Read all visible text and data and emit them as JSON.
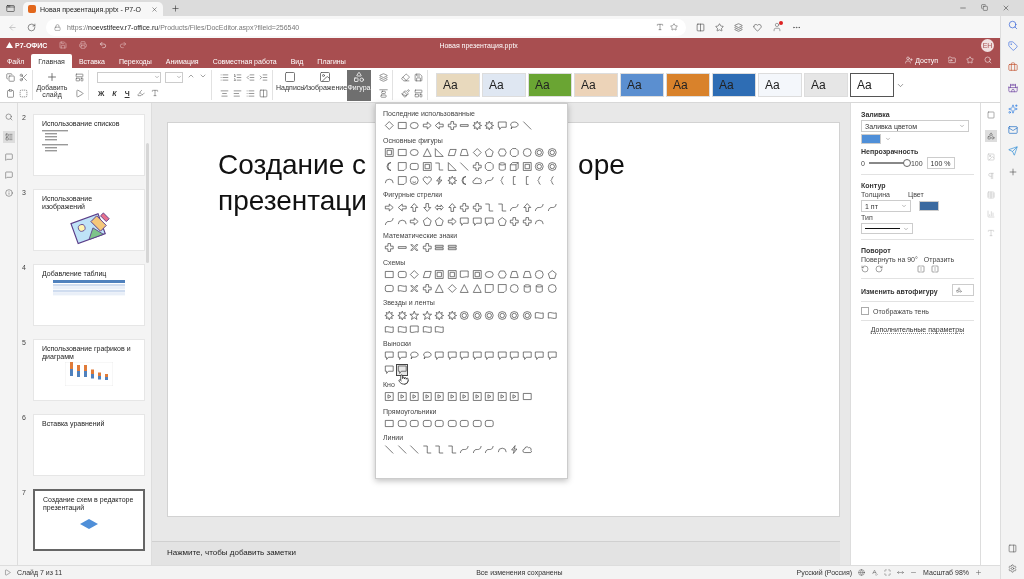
{
  "browser": {
    "tab_title": "Новая презентация.pptx - Р7-О",
    "url": "https://**noevstifeev.r7-office.ru**/Products/Files/DocEditor.aspx?fileid=256540"
  },
  "app": {
    "logo": "Р7-ОФИС",
    "title": "Новая презентация.pptx",
    "avatar": "ЕН",
    "share": "Доступ"
  },
  "menu": [
    {
      "label": "Файл",
      "selected": false
    },
    {
      "label": "Главная",
      "selected": true
    },
    {
      "label": "Вставка",
      "selected": false
    },
    {
      "label": "Переходы",
      "selected": false
    },
    {
      "label": "Анимация",
      "selected": false
    },
    {
      "label": "Совместная работа",
      "selected": false
    },
    {
      "label": "Вид",
      "selected": false
    },
    {
      "label": "Плагины",
      "selected": false
    }
  ],
  "toolbar": {
    "add_slide": "Добавить слайд",
    "bold": "Ж",
    "italic": "К",
    "underline": "Ч",
    "textbox": "Надпись",
    "image": "Изображение",
    "shape": {
      "label": "Фигура",
      "selected": true
    }
  },
  "themes": [
    {
      "label": "Aa",
      "color": "#e8d9bd",
      "selected": false
    },
    {
      "label": "Aa",
      "color": "#dfe7f2",
      "selected": false
    },
    {
      "label": "Aa",
      "color": "#6aa533",
      "selected": false
    },
    {
      "label": "Aa",
      "color": "#ecd3b8",
      "selected": false
    },
    {
      "label": "Aa",
      "color": "#5b8fd0",
      "selected": false
    },
    {
      "label": "Aa",
      "color": "#d9822b",
      "selected": false
    },
    {
      "label": "Aa",
      "color": "#2e6db4",
      "selected": false
    },
    {
      "label": "Aa",
      "color": "#f4f7fb",
      "selected": false
    },
    {
      "label": "Aa",
      "color": "#e6e6e6",
      "selected": false
    },
    {
      "label": "Aa",
      "color": "#ffffff",
      "selected": true
    }
  ],
  "slides": [
    {
      "number": "2",
      "title": "Использование списков",
      "kind": "list",
      "selected": false
    },
    {
      "number": "3",
      "title": "Использование изображений",
      "kind": "image",
      "selected": false
    },
    {
      "number": "4",
      "title": "Добавление таблиц",
      "kind": "table",
      "selected": false
    },
    {
      "number": "5",
      "title": "Использование графиков и диаграмм",
      "kind": "chart",
      "selected": false
    },
    {
      "number": "6",
      "title": "Вставка уравнений",
      "kind": "blank",
      "selected": false
    },
    {
      "number": "7",
      "title": "Создание схем в редакторе презентаций",
      "kind": "diamond",
      "selected": true
    }
  ],
  "slide_title": {
    "line1_start": "Создание с",
    "line1_end": "оре",
    "line2": "презентаци"
  },
  "shape_menu": {
    "sections": [
      {
        "title": "Последние использованные",
        "shapes": [
          {
            "kind": "diamond",
            "selected": false
          },
          {
            "kind": "rect",
            "selected": false
          },
          {
            "kind": "ellipse",
            "selected": false
          },
          {
            "kind": "arrow-right",
            "selected": false
          },
          {
            "kind": "arrow-left",
            "selected": false
          },
          {
            "kind": "cross",
            "selected": false
          },
          {
            "kind": "minus",
            "selected": false
          },
          {
            "kind": "burst",
            "selected": false
          },
          {
            "kind": "burst",
            "selected": false
          },
          {
            "kind": "callout",
            "selected": false
          },
          {
            "kind": "callout-round",
            "selected": false
          },
          {
            "kind": "line",
            "selected": false
          }
        ]
      },
      {
        "title": "Основные фигуры",
        "shapes": [
          {
            "kind": "frame",
            "selected": false
          },
          {
            "kind": "rect",
            "selected": false
          },
          {
            "kind": "ellipse",
            "selected": false
          },
          {
            "kind": "triangle",
            "selected": false
          },
          {
            "kind": "rtriangle",
            "selected": false
          },
          {
            "kind": "parallelogram",
            "selected": false
          },
          {
            "kind": "trapezoid",
            "selected": false
          },
          {
            "kind": "diamond",
            "selected": false
          },
          {
            "kind": "pentagon",
            "selected": false
          },
          {
            "kind": "hexagon",
            "selected": false
          },
          {
            "kind": "octagon",
            "selected": false
          },
          {
            "kind": "circle",
            "selected": false
          },
          {
            "kind": "donut",
            "selected": false
          },
          {
            "kind": "donut",
            "selected": false
          },
          {
            "kind": "moon",
            "selected": false
          },
          {
            "kind": "foldedcorner",
            "selected": false
          },
          {
            "kind": "rounded",
            "selected": false
          },
          {
            "kind": "frame",
            "selected": false
          },
          {
            "kind": "elbow",
            "selected": false
          },
          {
            "kind": "rtriangle",
            "selected": false
          },
          {
            "kind": "line",
            "selected": false
          },
          {
            "kind": "cross",
            "selected": false
          },
          {
            "kind": "octagon",
            "selected": false
          },
          {
            "kind": "cylinder",
            "selected": false
          },
          {
            "kind": "cube",
            "selected": false
          },
          {
            "kind": "frame",
            "selected": false
          },
          {
            "kind": "donut",
            "selected": false
          },
          {
            "kind": "donut",
            "selected": false
          },
          {
            "kind": "arc",
            "selected": false
          },
          {
            "kind": "foldedcorner",
            "selected": false
          },
          {
            "kind": "smiley",
            "selected": false
          },
          {
            "kind": "heart",
            "selected": false
          },
          {
            "kind": "lightning",
            "selected": false
          },
          {
            "kind": "burst",
            "selected": false
          },
          {
            "kind": "moon",
            "selected": false
          },
          {
            "kind": "cloud",
            "selected": false
          },
          {
            "kind": "curve",
            "selected": false
          },
          {
            "kind": "brace",
            "selected": false
          },
          {
            "kind": "bracket",
            "selected": false
          },
          {
            "kind": "bracket",
            "selected": false
          },
          {
            "kind": "brace",
            "selected": false
          },
          {
            "kind": "brace",
            "selected": false
          }
        ]
      },
      {
        "title": "Фигурные стрелки",
        "shapes": [
          {
            "kind": "arrow-right",
            "selected": false
          },
          {
            "kind": "arrow-left",
            "selected": false
          },
          {
            "kind": "arrow-up",
            "selected": false
          },
          {
            "kind": "arrow-down",
            "selected": false
          },
          {
            "kind": "arrow-leftright",
            "selected": false
          },
          {
            "kind": "arrow-up",
            "selected": false
          },
          {
            "kind": "cross",
            "selected": false
          },
          {
            "kind": "cross",
            "selected": false
          },
          {
            "kind": "elbow",
            "selected": false
          },
          {
            "kind": "elbow",
            "selected": false
          },
          {
            "kind": "curve",
            "selected": false
          },
          {
            "kind": "arrow-up",
            "selected": false
          },
          {
            "kind": "curve",
            "selected": false
          },
          {
            "kind": "curve",
            "selected": false
          },
          {
            "kind": "curve",
            "selected": false
          },
          {
            "kind": "arc",
            "selected": false
          },
          {
            "kind": "arrow-right",
            "selected": false
          },
          {
            "kind": "pentagon",
            "selected": false
          },
          {
            "kind": "pentagon",
            "selected": false
          },
          {
            "kind": "arrow-right",
            "selected": false
          },
          {
            "kind": "callout",
            "selected": false
          },
          {
            "kind": "callout",
            "selected": false
          },
          {
            "kind": "callout",
            "selected": false
          },
          {
            "kind": "pentagon",
            "selected": false
          },
          {
            "kind": "cross",
            "selected": false
          },
          {
            "kind": "cross",
            "selected": false
          },
          {
            "kind": "arc",
            "selected": false
          }
        ]
      },
      {
        "title": "Математические знаки",
        "shapes": [
          {
            "kind": "cross",
            "selected": false
          },
          {
            "kind": "minus",
            "selected": false
          },
          {
            "kind": "multiply",
            "selected": false
          },
          {
            "kind": "cross",
            "selected": false
          },
          {
            "kind": "equal",
            "selected": false
          },
          {
            "kind": "equal",
            "selected": false
          }
        ]
      },
      {
        "title": "Схемы",
        "shapes": [
          {
            "kind": "rect",
            "selected": false
          },
          {
            "kind": "rounded",
            "selected": false
          },
          {
            "kind": "diamond",
            "selected": false
          },
          {
            "kind": "parallelogram",
            "selected": false
          },
          {
            "kind": "frame",
            "selected": false
          },
          {
            "kind": "frame",
            "selected": false
          },
          {
            "kind": "document",
            "selected": false
          },
          {
            "kind": "frame",
            "selected": false
          },
          {
            "kind": "ellipse",
            "selected": false
          },
          {
            "kind": "hexagon",
            "selected": false
          },
          {
            "kind": "trapezoid",
            "selected": false
          },
          {
            "kind": "trapezoid",
            "selected": false
          },
          {
            "kind": "circle",
            "selected": false
          },
          {
            "kind": "pentagon",
            "selected": false
          },
          {
            "kind": "rounded",
            "selected": false
          },
          {
            "kind": "wave",
            "selected": false
          },
          {
            "kind": "multiply",
            "selected": false
          },
          {
            "kind": "cross",
            "selected": false
          },
          {
            "kind": "triangle",
            "selected": false
          },
          {
            "kind": "diamond",
            "selected": false
          },
          {
            "kind": "triangle",
            "selected": false
          },
          {
            "kind": "triangle",
            "selected": false
          },
          {
            "kind": "foldedcorner",
            "selected": false
          },
          {
            "kind": "foldedcorner",
            "selected": false
          },
          {
            "kind": "circle",
            "selected": false
          },
          {
            "kind": "cylinder",
            "selected": false
          },
          {
            "kind": "cylinder",
            "selected": false
          },
          {
            "kind": "circle",
            "selected": false
          }
        ]
      },
      {
        "title": "Звезды и ленты",
        "shapes": [
          {
            "kind": "burst",
            "selected": false
          },
          {
            "kind": "burst",
            "selected": false
          },
          {
            "kind": "star",
            "selected": false
          },
          {
            "kind": "star",
            "selected": false
          },
          {
            "kind": "burst",
            "selected": false
          },
          {
            "kind": "burst",
            "selected": false
          },
          {
            "kind": "donut",
            "selected": false
          },
          {
            "kind": "donut",
            "selected": false
          },
          {
            "kind": "donut",
            "selected": false
          },
          {
            "kind": "donut",
            "selected": false
          },
          {
            "kind": "donut",
            "selected": false
          },
          {
            "kind": "donut",
            "selected": false
          },
          {
            "kind": "wave",
            "selected": false
          },
          {
            "kind": "wave",
            "selected": false
          },
          {
            "kind": "wave",
            "selected": false
          },
          {
            "kind": "wave",
            "selected": false
          },
          {
            "kind": "document",
            "selected": false
          },
          {
            "kind": "wave",
            "selected": false
          },
          {
            "kind": "wave",
            "selected": false
          }
        ]
      },
      {
        "title": "Выноски",
        "shapes": [
          {
            "kind": "callout",
            "selected": false
          },
          {
            "kind": "callout",
            "selected": false
          },
          {
            "kind": "callout-round",
            "selected": false
          },
          {
            "kind": "callout-round",
            "selected": false
          },
          {
            "kind": "callout",
            "selected": false
          },
          {
            "kind": "callout",
            "selected": false
          },
          {
            "kind": "callout",
            "selected": false
          },
          {
            "kind": "callout",
            "selected": false
          },
          {
            "kind": "callout",
            "selected": false
          },
          {
            "kind": "callout",
            "selected": false
          },
          {
            "kind": "callout",
            "selected": false
          },
          {
            "kind": "callout",
            "selected": false
          },
          {
            "kind": "callout",
            "selected": false
          },
          {
            "kind": "callout",
            "selected": false
          },
          {
            "kind": "callout",
            "selected": false
          },
          {
            "kind": "callout",
            "selected": true
          }
        ]
      },
      {
        "title": "Кно",
        "shapes": [
          {
            "kind": "button",
            "selected": false
          },
          {
            "kind": "button",
            "selected": false
          },
          {
            "kind": "button",
            "selected": false
          },
          {
            "kind": "button",
            "selected": false
          },
          {
            "kind": "button",
            "selected": false
          },
          {
            "kind": "button",
            "selected": false
          },
          {
            "kind": "button",
            "selected": false
          },
          {
            "kind": "button",
            "selected": false
          },
          {
            "kind": "button",
            "selected": false
          },
          {
            "kind": "button",
            "selected": false
          },
          {
            "kind": "button",
            "selected": false
          },
          {
            "kind": "rect",
            "selected": false
          }
        ]
      },
      {
        "title": "Прямоугольники",
        "shapes": [
          {
            "kind": "rect",
            "selected": false
          },
          {
            "kind": "rounded",
            "selected": false
          },
          {
            "kind": "rounded",
            "selected": false
          },
          {
            "kind": "rounded",
            "selected": false
          },
          {
            "kind": "rounded",
            "selected": false
          },
          {
            "kind": "rounded",
            "selected": false
          },
          {
            "kind": "rounded",
            "selected": false
          },
          {
            "kind": "rounded",
            "selected": false
          },
          {
            "kind": "rounded",
            "selected": false
          }
        ]
      },
      {
        "title": "Линии",
        "shapes": [
          {
            "kind": "line",
            "selected": false
          },
          {
            "kind": "line",
            "selected": false
          },
          {
            "kind": "line",
            "selected": false
          },
          {
            "kind": "elbow",
            "selected": false
          },
          {
            "kind": "elbow",
            "selected": false
          },
          {
            "kind": "elbow",
            "selected": false
          },
          {
            "kind": "curve",
            "selected": false
          },
          {
            "kind": "curve",
            "selected": false
          },
          {
            "kind": "curve",
            "selected": false
          },
          {
            "kind": "arc",
            "selected": false
          },
          {
            "kind": "lightning",
            "selected": false
          },
          {
            "kind": "cloud",
            "selected": false
          }
        ]
      }
    ]
  },
  "notes": {
    "placeholder": "Нажмите, чтобы добавить заметки"
  },
  "shape_settings": {
    "fill_title": "Заливка",
    "fill_type": "Заливка цветом",
    "opacity_title": "Непрозрачность",
    "opacity_min": "0",
    "opacity_max": "100",
    "opacity": {
      "level": 1
    },
    "opacity_value": "100 %",
    "outline_title": "Контур",
    "width_label": "Толщина",
    "width_value": "1 пт",
    "color_label": "Цвет",
    "type_label": "Тип",
    "rotation_title": "Поворот",
    "rotate_label": "Повернуть на 90°",
    "flip_label": "Отразить",
    "change_shape": "Изменить автофигуру",
    "shadow": {
      "label": "Отображать тень",
      "checked": false
    },
    "advanced": "Дополнительные параметры"
  },
  "status_bar": {
    "slide": "Слайд 7 из 11",
    "saved": "Все изменения сохранены",
    "language": "Русский (Россия)",
    "zoom": "Масштаб 98%"
  }
}
